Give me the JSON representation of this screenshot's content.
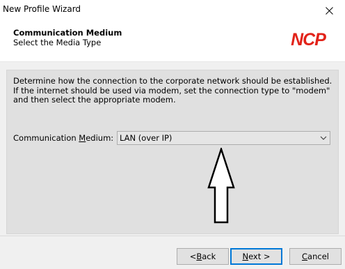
{
  "window": {
    "title": "New Profile Wizard"
  },
  "header": {
    "title": "Communication Medium",
    "subtitle": "Select the Media Type",
    "logo_text": "NCP",
    "logo_color": "#e2231a"
  },
  "main": {
    "description": "Determine how the connection to the corporate network should be established. If the internet should be used via modem, set the connection type to \"modem\" and then select the appropriate modem.",
    "medium_label_pre": "Communication ",
    "medium_label_mnemonic": "M",
    "medium_label_post": "edium:",
    "medium_value": "LAN (over IP)"
  },
  "buttons": {
    "back_pre": "< ",
    "back_mnemonic": "B",
    "back_post": "ack",
    "next_mnemonic": "N",
    "next_post": "ext >",
    "cancel_mnemonic": "C",
    "cancel_post": "ancel"
  }
}
